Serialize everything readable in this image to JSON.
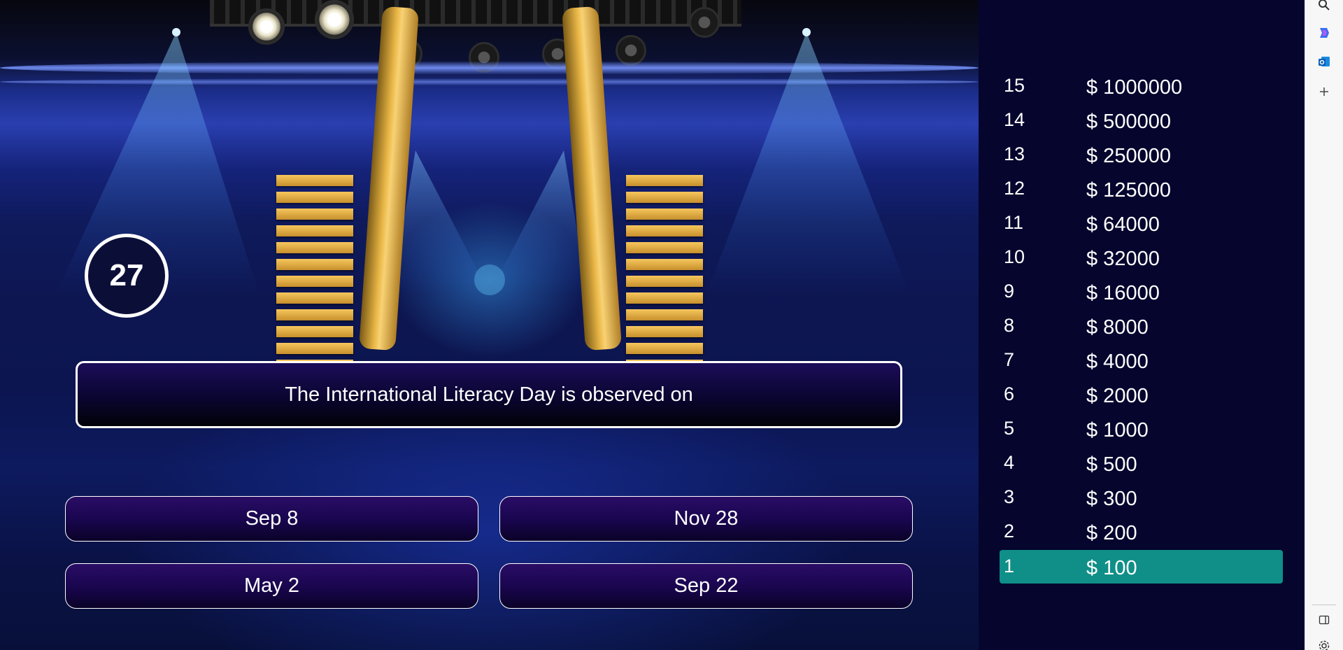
{
  "game": {
    "timer": "27",
    "question": "The International Literacy Day is observed on",
    "answers": [
      {
        "label": "Sep 8"
      },
      {
        "label": "Nov 28"
      },
      {
        "label": "May 2"
      },
      {
        "label": "Sep 22"
      }
    ]
  },
  "ladder": {
    "current_level": "1",
    "levels": [
      {
        "level": "15",
        "amount": "$ 1000000"
      },
      {
        "level": "14",
        "amount": "$ 500000"
      },
      {
        "level": "13",
        "amount": "$ 250000"
      },
      {
        "level": "12",
        "amount": "$ 125000"
      },
      {
        "level": "11",
        "amount": "$ 64000"
      },
      {
        "level": "10",
        "amount": "$ 32000"
      },
      {
        "level": "9",
        "amount": "$ 16000"
      },
      {
        "level": "8",
        "amount": "$ 8000"
      },
      {
        "level": "7",
        "amount": "$ 4000"
      },
      {
        "level": "6",
        "amount": "$ 2000"
      },
      {
        "level": "5",
        "amount": "$ 1000"
      },
      {
        "level": "4",
        "amount": "$ 500"
      },
      {
        "level": "3",
        "amount": "$ 300"
      },
      {
        "level": "2",
        "amount": "$ 200"
      },
      {
        "level": "1",
        "amount": "$ 100"
      }
    ]
  },
  "sidebar": {
    "icons": [
      "search-icon",
      "copilot-icon",
      "outlook-icon",
      "add-icon",
      "sidebar-toggle-icon",
      "settings-icon"
    ]
  },
  "colors": {
    "ladder_bg": "#05052e",
    "current_level_highlight": "#0f8f88",
    "question_border": "#ffffff",
    "answer_bg": "#1a0650"
  }
}
